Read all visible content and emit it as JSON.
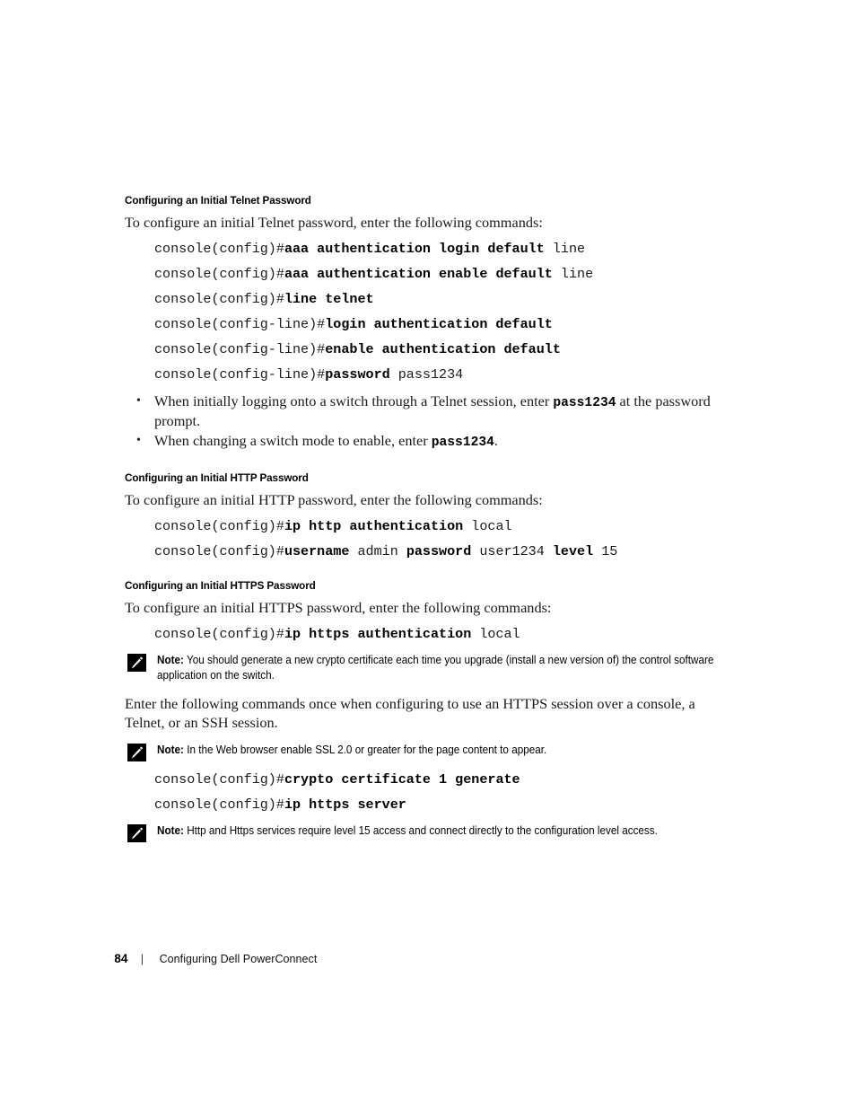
{
  "document": {
    "page_number": "84",
    "footer_separator": "|",
    "footer_title": "Configuring Dell PowerConnect"
  },
  "sections": [
    {
      "heading": "Configuring an Initial Telnet Password",
      "intro": "To configure an initial Telnet password, enter the following commands:",
      "commands": [
        {
          "prompt": "console(config)#",
          "bold": "aaa authentication login default",
          "plain": " line"
        },
        {
          "prompt": "console(config)#",
          "bold": "aaa authentication enable default",
          "plain": " line"
        },
        {
          "prompt": "console(config)#",
          "bold": "line telnet",
          "plain": ""
        },
        {
          "prompt": "console(config-line)#",
          "bold": "login authentication default",
          "plain": ""
        },
        {
          "prompt": "console(config-line)#",
          "bold": "enable authentication default",
          "plain": ""
        },
        {
          "prompt": "console(config-line)#",
          "bold": "password",
          "plain": " pass1234"
        }
      ],
      "bullets": [
        {
          "pre": "When initially logging onto a switch through a Telnet session, enter ",
          "mono": "pass1234",
          "post": "  at the password prompt."
        },
        {
          "pre": "When changing a switch mode to enable, enter ",
          "mono": "pass1234",
          "post": "."
        }
      ]
    },
    {
      "heading": "Configuring an Initial HTTP Password",
      "intro": "To configure an initial HTTP password, enter the following commands:",
      "commands": [
        {
          "prompt": "console(config)#",
          "bold": "ip http authentication",
          "plain": " local"
        },
        {
          "prompt": "console(config)#",
          "segments": [
            {
              "text": "username",
              "bold": true
            },
            {
              "text": " admin ",
              "bold": false
            },
            {
              "text": "password",
              "bold": true
            },
            {
              "text": " user1234 ",
              "bold": false
            },
            {
              "text": "level",
              "bold": true
            },
            {
              "text": " 15",
              "bold": false
            }
          ]
        }
      ]
    },
    {
      "heading": "Configuring an Initial HTTPS Password",
      "intro": "To configure an initial HTTPS password, enter the following commands:",
      "commands": [
        {
          "prompt": "console(config)#",
          "bold": "ip https authentication",
          "plain": " local"
        }
      ]
    }
  ],
  "notes": [
    {
      "label": "Note:",
      "text": " You should generate a new crypto certificate each time you upgrade (install a new version of) the control software application on the switch.",
      "icon": "note-pencil-icon"
    },
    {
      "label": "Note:",
      "text": " In the Web browser enable SSL 2.0 or greater for the page content to appear.",
      "icon": "note-pencil-icon"
    },
    {
      "label": "Note:",
      "text": " Http and Https services require level 15 access and connect directly to the configuration level access.",
      "icon": "note-pencil-icon"
    }
  ],
  "paragraphs": {
    "https_session": "Enter the following commands once when configuring to use an HTTPS session over a console, a Telnet, or an SSH session."
  },
  "trailing_commands": [
    {
      "prompt": "console(config)#",
      "bold": "crypto certificate 1 generate",
      "plain": ""
    },
    {
      "prompt": "console(config)#",
      "bold": "ip https server",
      "plain": ""
    }
  ]
}
